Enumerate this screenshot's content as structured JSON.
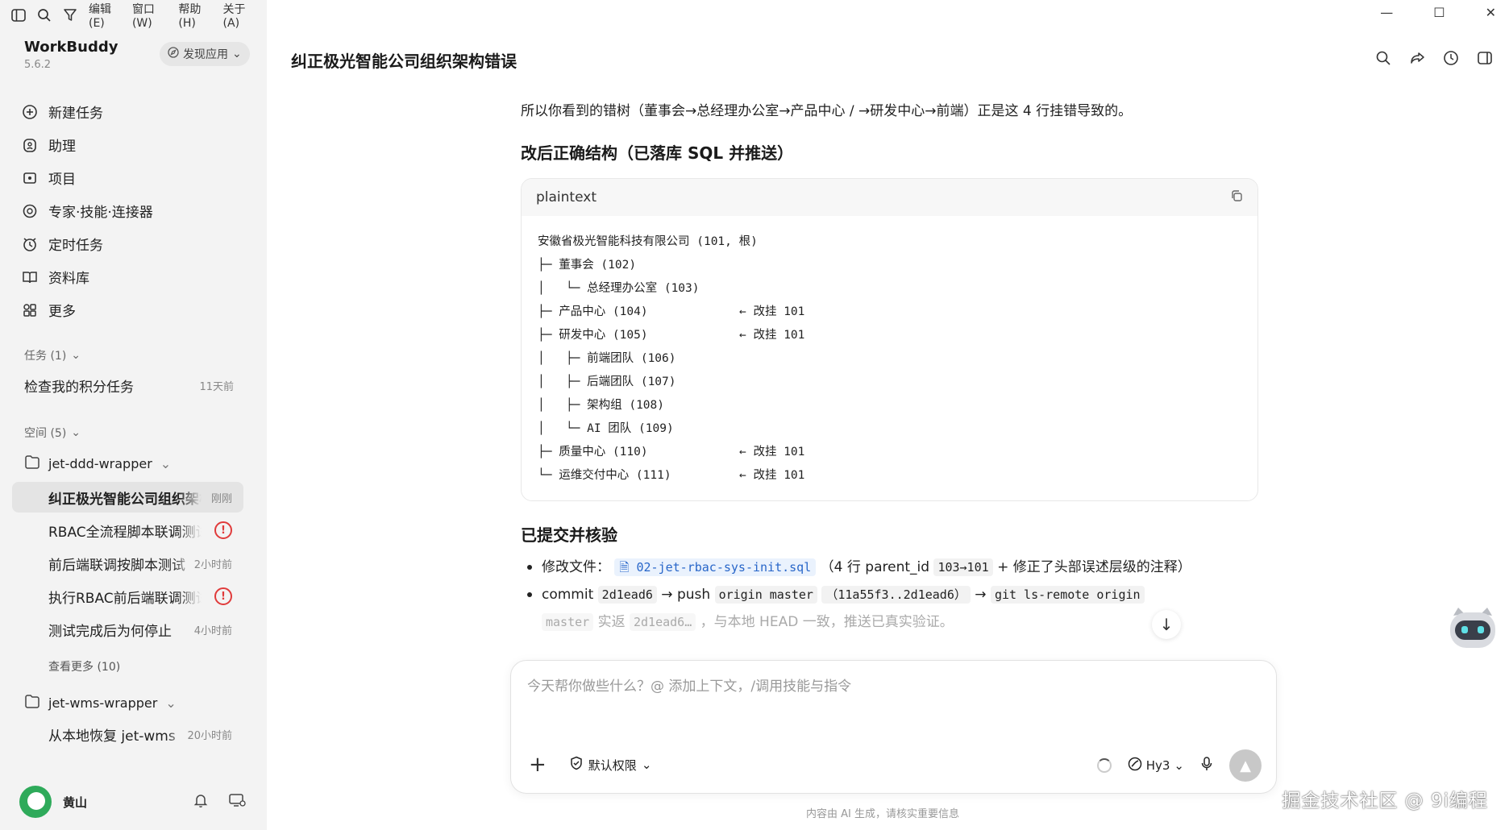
{
  "menubar": {
    "items": [
      "编辑(E)",
      "窗口(W)",
      "帮助(H)",
      "关于(A)"
    ]
  },
  "brand": {
    "name": "WorkBuddy",
    "version": "5.6.2",
    "discover_label": "发现应用"
  },
  "nav": [
    {
      "label": "新建任务",
      "icon": "plus-circle-icon"
    },
    {
      "label": "助理",
      "icon": "assistant-icon"
    },
    {
      "label": "项目",
      "icon": "project-icon"
    },
    {
      "label": "专家·技能·连接器",
      "icon": "expert-icon"
    },
    {
      "label": "定时任务",
      "icon": "alarm-icon"
    },
    {
      "label": "资料库",
      "icon": "book-icon"
    },
    {
      "label": "更多",
      "icon": "grid-icon"
    }
  ],
  "tasks_section": {
    "header": "任务 (1)",
    "item": {
      "label": "检查我的积分任务",
      "time": "11天前"
    }
  },
  "spaces_section": {
    "header": "空间 (5)",
    "space1": {
      "name": "jet-ddd-wrapper",
      "items": [
        {
          "label": "纠正极光智能公司组织架构错误",
          "time": "刚刚"
        },
        {
          "label": "RBAC全流程脚本联调测试",
          "time": ""
        },
        {
          "label": "前后端联调按脚本测试",
          "time": "2小时前"
        },
        {
          "label": "执行RBAC前后端联调测试",
          "time": ""
        },
        {
          "label": "测试完成后为何停止",
          "time": "4小时前"
        }
      ],
      "see_more": "查看更多 (10)"
    },
    "space2": {
      "name": "jet-wms-wrapper",
      "items": [
        {
          "label": "从本地恢复 jet-wms",
          "time": "20小时前"
        }
      ]
    }
  },
  "user": {
    "name": "黄山"
  },
  "main": {
    "title": "纠正极光智能公司组织架构错误",
    "intro": "所以你看到的错树（董事会→总经理办公室→产品中心 / →研发中心→前端）正是这 4 行挂错导致的。",
    "section1_title": "改后正确结构（已落库 SQL 并推送）",
    "code": {
      "lang": "plaintext",
      "lines": [
        {
          "tree": "安徽省极光智能科技有限公司 (101, 根)",
          "note": ""
        },
        {
          "tree": "├─ 董事会 (102)",
          "note": ""
        },
        {
          "tree": "│   └─ 总经理办公室 (103)",
          "note": ""
        },
        {
          "tree": "├─ 产品中心 (104)",
          "note": "← 改挂 101"
        },
        {
          "tree": "├─ 研发中心 (105)",
          "note": "← 改挂 101"
        },
        {
          "tree": "│   ├─ 前端团队 (106)",
          "note": ""
        },
        {
          "tree": "│   ├─ 后端团队 (107)",
          "note": ""
        },
        {
          "tree": "│   ├─ 架构组 (108)",
          "note": ""
        },
        {
          "tree": "│   └─ AI 团队 (109)",
          "note": ""
        },
        {
          "tree": "├─ 质量中心 (110)",
          "note": "← 改挂 101"
        },
        {
          "tree": "└─ 运维交付中心 (111)",
          "note": "← 改挂 101"
        }
      ]
    },
    "section2_title": "已提交并核验",
    "bullet1": {
      "prefix": "修改文件：",
      "file": "02-jet-rbac-sys-init.sql",
      "mid": "（4 行 parent_id",
      "code": "103→101",
      "suffix": "+ 修正了头部误述层级的注释）"
    },
    "bullet2": {
      "commit_label": "commit",
      "commit_hash": "2d1ead6",
      "arrow_push": "→ push",
      "origin_master": "origin master",
      "range": "（11a55f3..2d1ead6）",
      "arrow2": "→",
      "ls_remote": "git ls-remote origin",
      "line2_code": "master",
      "line2_a": "实返",
      "line2_hash": "2d1ead6…",
      "line2_b": "，与本地 HEAD 一致，推送已真实验证。"
    }
  },
  "composer": {
    "placeholder": "今天帮你做些什么？@ 添加上下文，/调用技能与指令",
    "permission_label": "默认权限",
    "model_label": "Hy3"
  },
  "disclaimer": "内容由 AI 生成，请核实重要信息",
  "watermark": "掘金技术社区 @ 9i编程"
}
